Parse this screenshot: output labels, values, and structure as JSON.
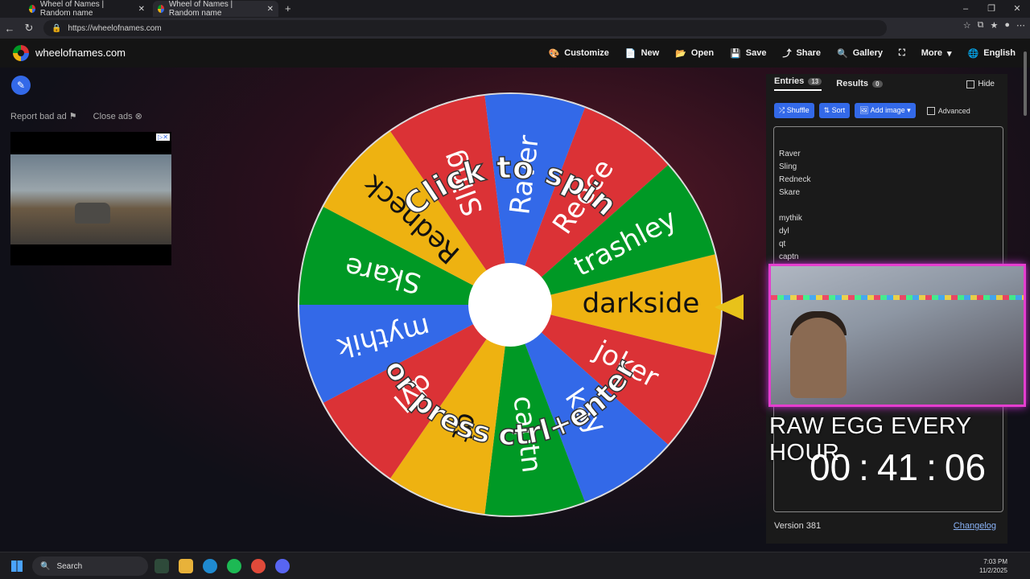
{
  "browser": {
    "tabs": [
      {
        "label": "Wheel of Names | Random name"
      },
      {
        "label": "Wheel of Names | Random name"
      }
    ],
    "url": "https://wheelofnames.com"
  },
  "header": {
    "site_title": "wheelofnames.com",
    "menu": [
      "Customize",
      "New",
      "Open",
      "Save",
      "Share",
      "Gallery",
      "More",
      "English"
    ]
  },
  "left": {
    "report_ad": "Report bad ad",
    "close_ads": "Close ads"
  },
  "wheel": {
    "prompt_top": "Click to spin",
    "prompt_bottom": "or press ctrl+enter",
    "segments": [
      "darkside",
      "joker",
      "kay",
      "captn",
      "qt",
      "dyl",
      "mythik",
      "Skare",
      "Redneck",
      "Sling",
      "Raver",
      "Reece",
      "trashley"
    ],
    "colors": [
      "#eeb211",
      "#db3236",
      "#3369e8",
      "#009925",
      "#eeb211",
      "#db3236",
      "#3369e8",
      "#009925",
      "#eeb211",
      "#db3236",
      "#3369e8",
      "#db3236",
      "#009925"
    ]
  },
  "panel": {
    "tab_entries": "Entries",
    "entries_count": "13",
    "tab_results": "Results",
    "results_count": "0",
    "hide": "Hide",
    "btn_shuffle": "Shuffle",
    "btn_sort": "Sort",
    "btn_add_image": "Add image",
    "advanced": "Advanced",
    "entries": [
      "Raver",
      "Sling",
      "Redneck",
      "Skare",
      "",
      "mythik",
      "dyl",
      "qt",
      "captn"
    ],
    "version": "Version 381",
    "changelog": "Changelog"
  },
  "overlay": {
    "title": "RAW EGG EVERY HOUR",
    "hours": "00",
    "minutes": "41",
    "seconds": "06"
  },
  "taskbar": {
    "search": "Search",
    "time": "7:03 PM",
    "date": "11/2/2025"
  }
}
